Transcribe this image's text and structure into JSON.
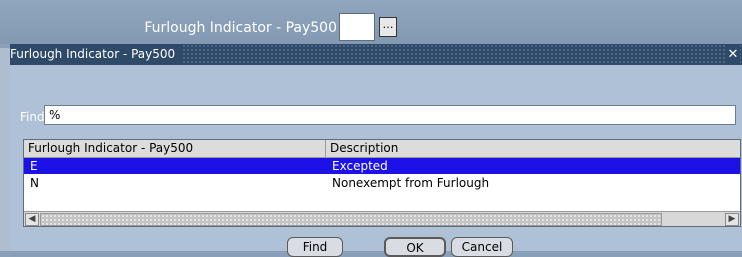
{
  "background": {
    "field_label": "Furlough Indicator - Pay500",
    "lov_button_label": "…"
  },
  "dialog": {
    "title": "Furlough Indicator - Pay500",
    "close_label": "✕",
    "find": {
      "label": "Find",
      "value": "%"
    },
    "table": {
      "columns": [
        "Furlough Indicator - Pay500",
        "Description"
      ],
      "rows": [
        {
          "code": "E",
          "description": "Excepted",
          "selected": true
        },
        {
          "code": "N",
          "description": "Nonexempt from Furlough",
          "selected": false
        }
      ]
    },
    "scroll": {
      "left_arrow": "◀",
      "right_arrow": "▶"
    },
    "buttons": {
      "find": "Find",
      "ok": "OK",
      "cancel": "Cancel"
    }
  },
  "colors": {
    "selection": "#1c12e8",
    "titlebar": "#2f4a68",
    "dialog_bg": "#aec1d6"
  }
}
